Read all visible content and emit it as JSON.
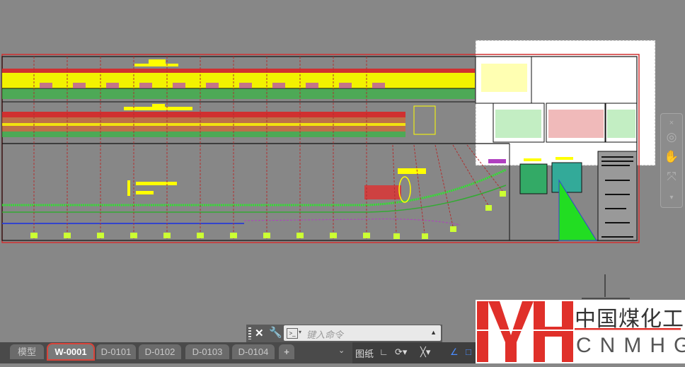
{
  "layout_tabs": [
    {
      "label": "模型",
      "active": false
    },
    {
      "label": "W-0001",
      "active": true
    },
    {
      "label": "D-0101",
      "active": false
    },
    {
      "label": "D-0102",
      "active": false
    },
    {
      "label": "D-0103",
      "active": false
    },
    {
      "label": "D-0104",
      "active": false
    }
  ],
  "add_tab_label": "+",
  "command_line": {
    "placeholder": "键入命令",
    "close": "✕",
    "settings_icon": "wrench-icon"
  },
  "status_bar": {
    "paper_label": "图纸"
  },
  "watermark": {
    "cn": "中国煤化工",
    "en": "CNMHG",
    "mark": "MH"
  },
  "colors": {
    "frame": "#d03030",
    "grid": "#b03030",
    "yellow": "#ffff00",
    "green": "#33cc33",
    "accent": "#d9443a"
  }
}
